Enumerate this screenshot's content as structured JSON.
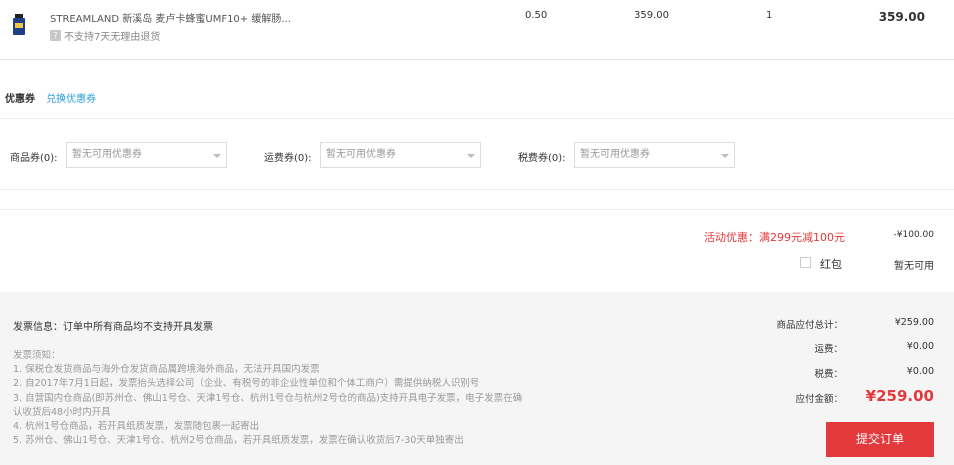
{
  "product": {
    "name": "STREAMLAND 新溪岛 麦卢卡蜂蜜UMF10+ 缓解肠...",
    "return_policy_icon": "?",
    "return_policy": "不支持7天无理由退货",
    "tax": "0.50",
    "unit_price": "359.00",
    "quantity": "1",
    "subtotal": "359.00"
  },
  "coupon": {
    "title": "优惠券",
    "exchange_link": "兑换优惠券",
    "product_coupon_label": "商品券(0):",
    "product_coupon_value": "暂无可用优惠券",
    "shipping_coupon_label": "运费券(0):",
    "shipping_coupon_value": "暂无可用优惠券",
    "tax_coupon_label": "税费券(0):",
    "tax_coupon_value": "暂无可用优惠券"
  },
  "promotion": {
    "label": "活动优惠：满299元减100元",
    "value": "-¥100.00"
  },
  "red_packet": {
    "label": "红包",
    "value": "暂无可用"
  },
  "invoice": {
    "title": "发票信息：订单中所有商品均不支持开具发票",
    "notes_title": "发票须知：",
    "notes": [
      "1. 保税仓发货商品与海外仓发货商品属跨境海外商品，无法开具国内发票",
      "2. 自2017年7月1日起，发票抬头选择公司（企业、有税号的非企业性单位和个体工商户）需提供纳税人识别号",
      "3. 自营国内仓商品(即苏州仓、佛山1号仓、天津1号仓、杭州1号仓与杭州2号仓的商品)支持开具电子发票，电子发票在确",
      "认收货后48小时内开具",
      "4. 杭州1号仓商品，若开具纸质发票，发票随包裹一起寄出",
      "5. 苏州仓、佛山1号仓、天津1号仓、杭州2号仓商品，若开具纸质发票，发票在确认收货后7-30天单独寄出"
    ]
  },
  "summary": {
    "goods_total_label": "商品应付总计：",
    "goods_total_value": "¥259.00",
    "shipping_label": "运费：",
    "shipping_value": "¥0.00",
    "tax_label": "税费：",
    "tax_value": "¥0.00",
    "payable_label": "应付金额：",
    "payable_value": "¥259.00"
  },
  "submit_label": "提交订单",
  "colors": {
    "accent_red": "#e4393c",
    "link_blue": "#2aa0d8"
  }
}
